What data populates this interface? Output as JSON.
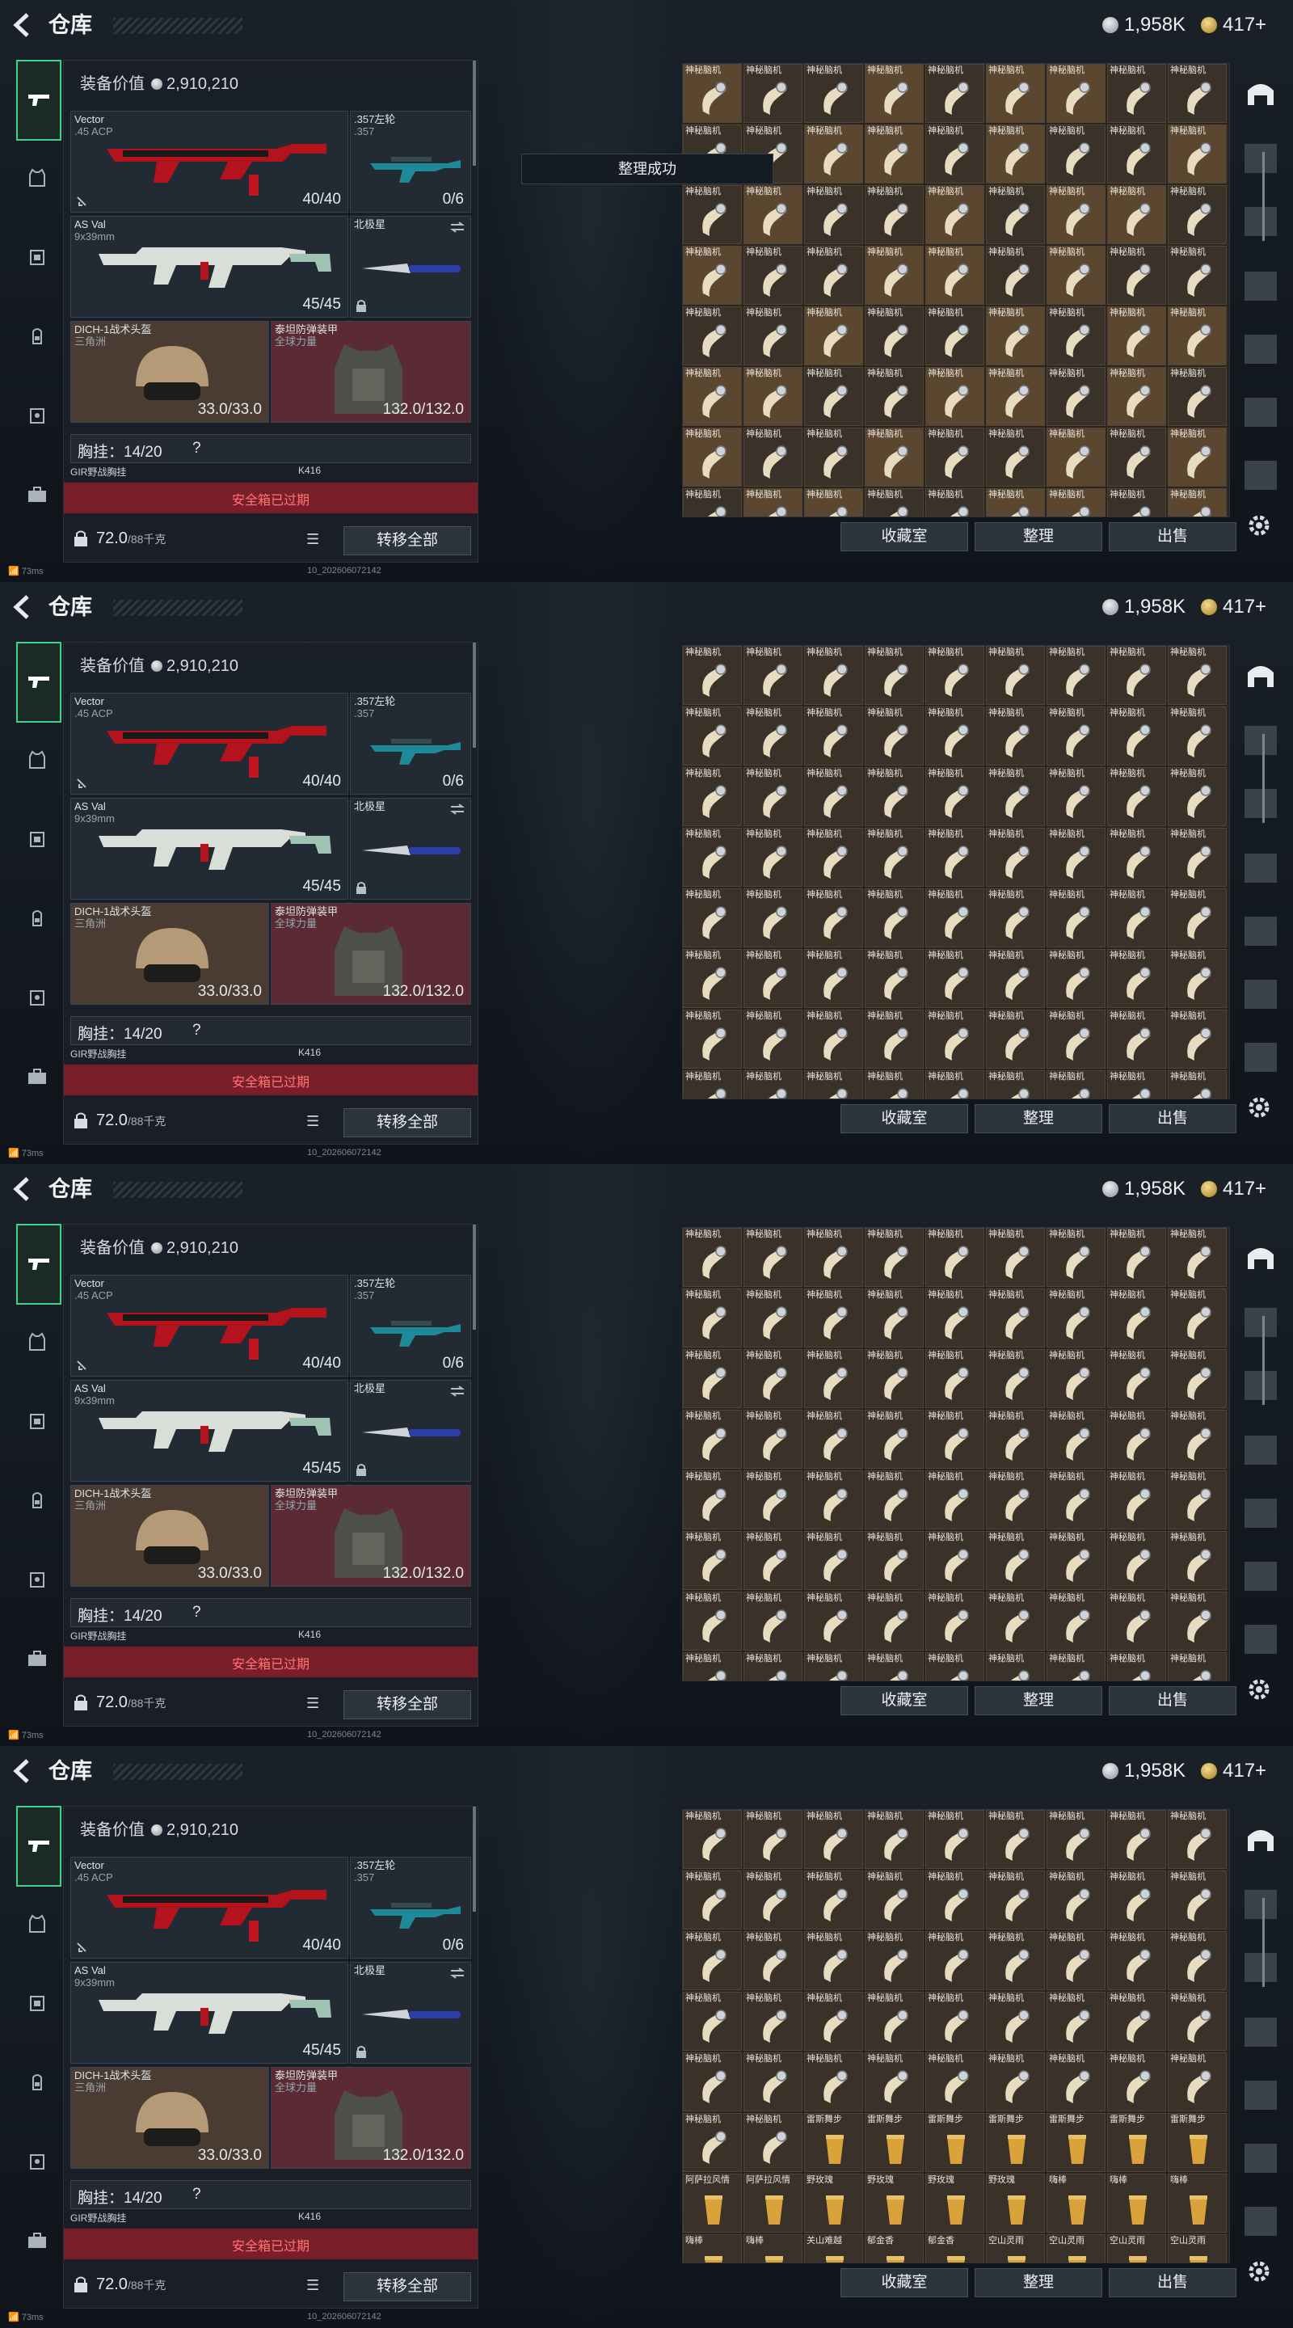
{
  "header": {
    "title": "仓库",
    "currency_silver": "1,958K",
    "currency_gold": "417+"
  },
  "equipment": {
    "value_label": "装备价值",
    "value": "2,910,210",
    "primary": {
      "name": "Vector",
      "ammo": ".45 ACP",
      "count": "40/40"
    },
    "sidearm": {
      "name": ".357左轮",
      "ammo": ".357",
      "count": "0/6"
    },
    "secondary": {
      "name": "AS Val",
      "ammo": "9x39mm",
      "count": "45/45"
    },
    "melee": {
      "name": "北极星"
    },
    "helmet": {
      "name": "DICH-1战术头盔",
      "maker": "三角洲",
      "durability": "33.0/33.0"
    },
    "armor": {
      "name": "泰坦防弹装甲",
      "maker": "全球力量",
      "durability": "132.0/132.0"
    },
    "chest": {
      "label": "胸挂：",
      "value": "14/20",
      "help": "?"
    },
    "chest_item": "GIR野战胸挂",
    "backpack_item": "K416",
    "safebox": "安全箱已过期",
    "weight": "72.0",
    "weight_max": "/88千克",
    "transfer_all": "转移全部"
  },
  "toast": "整理成功",
  "actions": {
    "collection": "收藏室",
    "sort": "整理",
    "sell": "出售"
  },
  "status": {
    "ping": "73ms",
    "build": "10_202606072142"
  },
  "grid": {
    "item_name": "神秘脑机",
    "screen4_row6": [
      "神秘脑机",
      "神秘脑机",
      "雷斯舞步",
      "雷斯舞步",
      "雷斯舞步",
      "雷斯舞步",
      "雷斯舞步",
      "雷斯舞步",
      "雷斯舞步"
    ],
    "screen4_row7": [
      "阿萨拉风情",
      "阿萨拉风情",
      "野玫瑰",
      "野玫瑰",
      "野玫瑰",
      "野玫瑰",
      "嗨棒",
      "嗨棒",
      "嗨棒"
    ],
    "screen4_row8": [
      "嗨棒",
      "嗨棒",
      "关山难越",
      "郁金香",
      "郁金香",
      "空山灵雨",
      "空山灵雨",
      "空山灵雨",
      "空山灵雨"
    ]
  },
  "colors": {
    "accent_green": "#3fd38a",
    "danger_red": "#ff7474",
    "armor_bg": "#5a2b34",
    "helmet_bg": "#4a3c33"
  }
}
